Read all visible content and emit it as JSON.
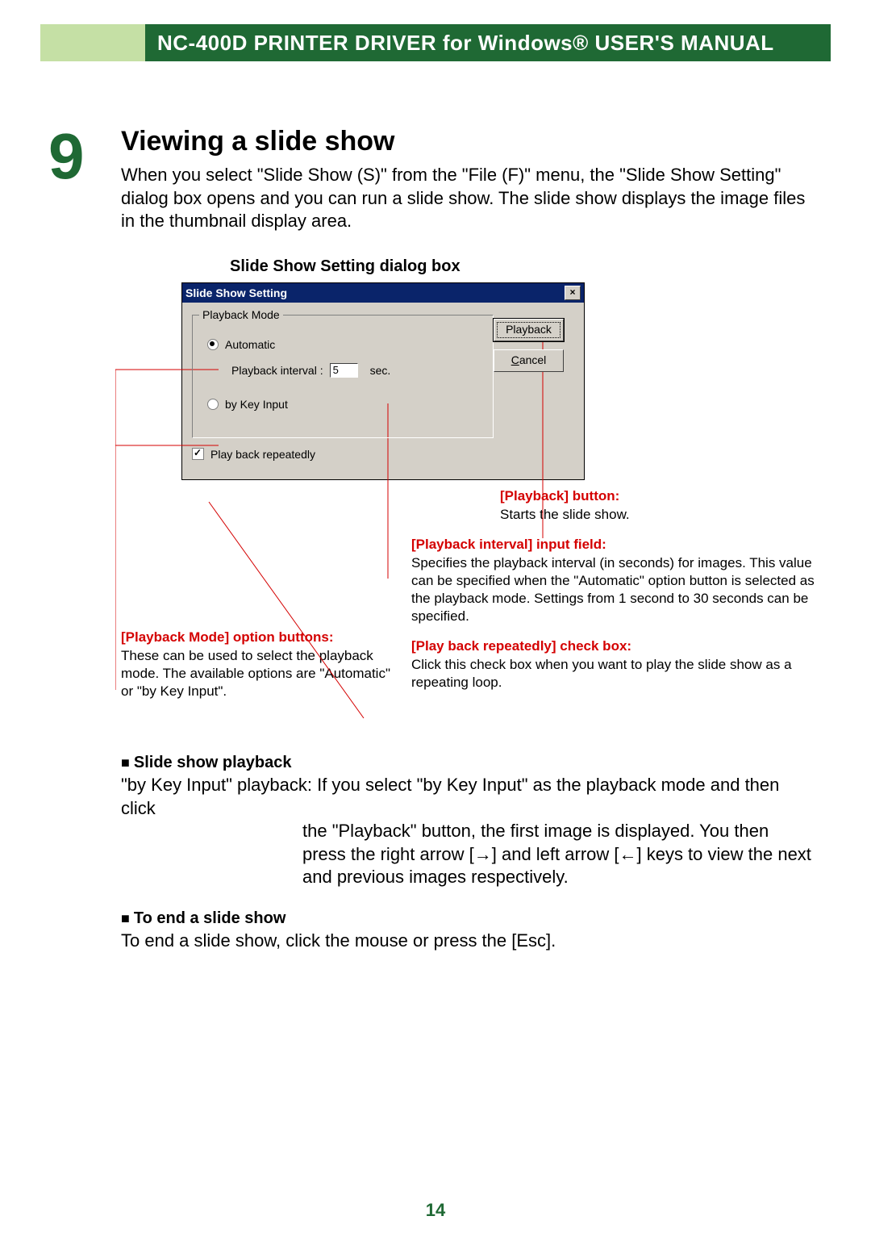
{
  "header": {
    "title": "NC-400D PRINTER DRIVER for Windows® USER'S MANUAL"
  },
  "chapter": {
    "number": "9",
    "title": "Viewing a slide show",
    "intro": "When you select \"Slide Show (S)\" from the \"File (F)\" menu, the \"Slide Show Setting\" dialog box opens and you can run a slide show. The slide show displays the image files in the thumbnail display area."
  },
  "caption": "Slide Show Setting dialog box",
  "dialog": {
    "title": "Slide Show Setting",
    "close": "×",
    "group_label": "Playback Mode",
    "radio_auto": "Automatic",
    "interval_label": "Playback interval :",
    "interval_value": "5",
    "interval_unit": "sec.",
    "radio_key": "by Key Input",
    "checkbox_repeat": "Play back repeatedly",
    "btn_playback": "Playback",
    "btn_cancel_prefix": "C",
    "btn_cancel_rest": "ancel"
  },
  "annotations": {
    "playback_btn": {
      "title": "[Playback] button:",
      "body": "Starts the slide show."
    },
    "interval": {
      "title": "[Playback interval] input field:",
      "body": "Specifies the playback interval (in seconds) for images. This value can be specified when the \"Automatic\" option button is selected as the playback mode. Settings from 1 second to 30 seconds can be specified."
    },
    "mode": {
      "title": "[Playback Mode] option buttons:",
      "body": "These can be used to select the playback mode. The available options are \"Automatic\" or \"by Key Input\"."
    },
    "repeat": {
      "title": "[Play back repeatedly] check box:",
      "body": "Click this check box when you want to play the slide show as a repeating loop."
    }
  },
  "bullet1": {
    "title": "Slide show playback",
    "first_line": "\"by Key Input\" playback: If you select \"by Key Input\" as the playback mode and then click",
    "rest": "the \"Playback\" button, the first image is displayed. You then press the right arrow [→] and left arrow [←] keys to view the next and previous images respectively."
  },
  "bullet2": {
    "title": "To end a slide show",
    "body": "To end a slide show, click the mouse or press the [Esc]."
  },
  "page_number": "14"
}
